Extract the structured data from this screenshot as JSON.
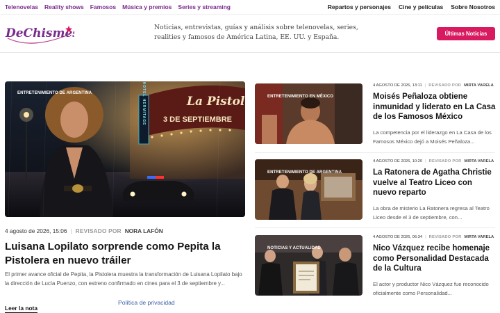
{
  "topnav": {
    "left": [
      "Telenovelas",
      "Reality shows",
      "Famosos",
      "Música y premios",
      "Series y streaming"
    ],
    "right": [
      "Repartos y personajes",
      "Cine y películas",
      "Sobre Nosotros"
    ]
  },
  "header": {
    "logo_text": "DeChismes",
    "tagline": "Noticias, entrevistas, guías y análisis sobre telenovelas, series, realities y famosos de América Latina, EE. UU. y España.",
    "cta": "Últimas Noticias"
  },
  "colors": {
    "accent": "#d81b60",
    "nav": "#7a2a8c",
    "link": "#3c5fa8"
  },
  "main": {
    "tag": "Entretenimiento de Argentina",
    "marquee_text": "La Pistolera",
    "marquee_date": "3 DE SEPTIEMBRE",
    "hotel_sign": "HOTEL HERMITAGE",
    "date": "4 agosto de 2026, 15:06",
    "reviewed_label": "REVISADO POR",
    "author": "NORA LAFÓN",
    "title": "Luisana Lopilato sorprende como Pepita la Pistolera en nuevo tráiler",
    "excerpt": "El primer avance oficial de Pepita, la Pistolera muestra la transformación de Luisana Lopilato bajo la dirección de Lucía Puenzo, con estreno confirmado en cines para el 3 de septiembre y...",
    "read_more": "Leer la nota"
  },
  "privacy": "Política de privacidad",
  "cards": [
    {
      "tag": "Entretenimiento en México",
      "date": "4 AGOSTO DE 2026, 13:11",
      "reviewed_label": "REVISADO POR",
      "author": "MIRTA VARELA",
      "title": "Moisés Peñaloza obtiene inmunidad y liderato en La Casa de los Famosos México",
      "excerpt": "La competencia por el liderazgo en La Casa de los Famosos México dejó a Moisés Peñaloza..."
    },
    {
      "tag": "Entretenimiento de Argentina",
      "date": "4 AGOSTO DE 2026, 10:20",
      "reviewed_label": "REVISADO POR",
      "author": "MIRTA VARELA",
      "title": "La Ratonera de Agatha Christie vuelve al Teatro Liceo con nuevo reparto",
      "excerpt": "La obra de misterio La Ratonera regresa al Teatro Liceo desde el 3 de septiembre, con..."
    },
    {
      "tag": "Noticias y actualidad",
      "date": "4 AGOSTO DE 2026, 06:34",
      "reviewed_label": "REVISADO POR",
      "author": "MIRTA VARELA",
      "title": "Nico Vázquez recibe homenaje como Personalidad Destacada de la Cultura",
      "excerpt": "El actor y productor Nico Vázquez fue reconocido oficialmente como Personalidad..."
    }
  ]
}
